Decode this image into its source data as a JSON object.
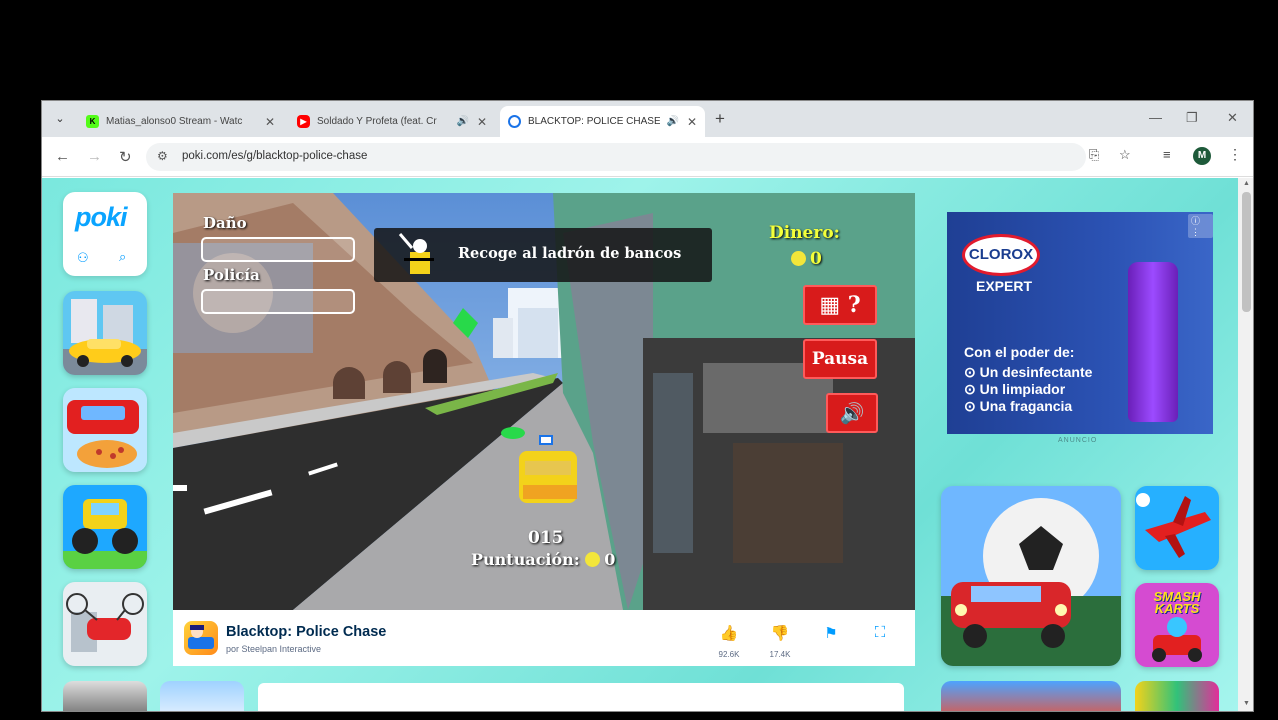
{
  "tabs": [
    {
      "title": "Matias_alonso0 Stream - Watc",
      "favicon": "kick-icon",
      "color": "#53fc18"
    },
    {
      "title": "Soldado Y Profeta (feat. Cr",
      "favicon": "youtube-icon",
      "color": "#ff0000"
    },
    {
      "title": "BLACKTOP: POLICE CHASE",
      "favicon": "poki-icon",
      "color": "#009cff"
    }
  ],
  "address": {
    "url": "poki.com/es/g/blacktop-police-chase"
  },
  "profile": {
    "initial": "M"
  },
  "poki": {
    "logo": "poki"
  },
  "game": {
    "hud": {
      "damage_label": "Daño",
      "police_label": "Policía",
      "mission_text": "Recoge al ladrón de bancos",
      "money_label": "Dinero:",
      "money_value": "0",
      "pause_label": "Pausa",
      "score_value": "015",
      "score_label": "Puntuación:",
      "score_coins": "0"
    }
  },
  "game_info": {
    "title": "Blacktop: Police Chase",
    "developer": "por Steelpan Interactive",
    "likes": "92.6K",
    "dislikes": "17.4K"
  },
  "ad": {
    "brand": "CLOROX",
    "sub": "EXPERT",
    "headline": "Con el poder de:",
    "bullets": [
      "Un desinfectante",
      "Un limpiador",
      "Una fragancia"
    ],
    "label": "ANUNCIO"
  },
  "right_games": [
    {
      "name": "SMASH KARTS"
    }
  ],
  "colors": {
    "poki_blue": "#009cff",
    "page_bg": "#7ae8de",
    "hud_red": "#d81b1b",
    "money_yellow": "#f3ff3a"
  }
}
